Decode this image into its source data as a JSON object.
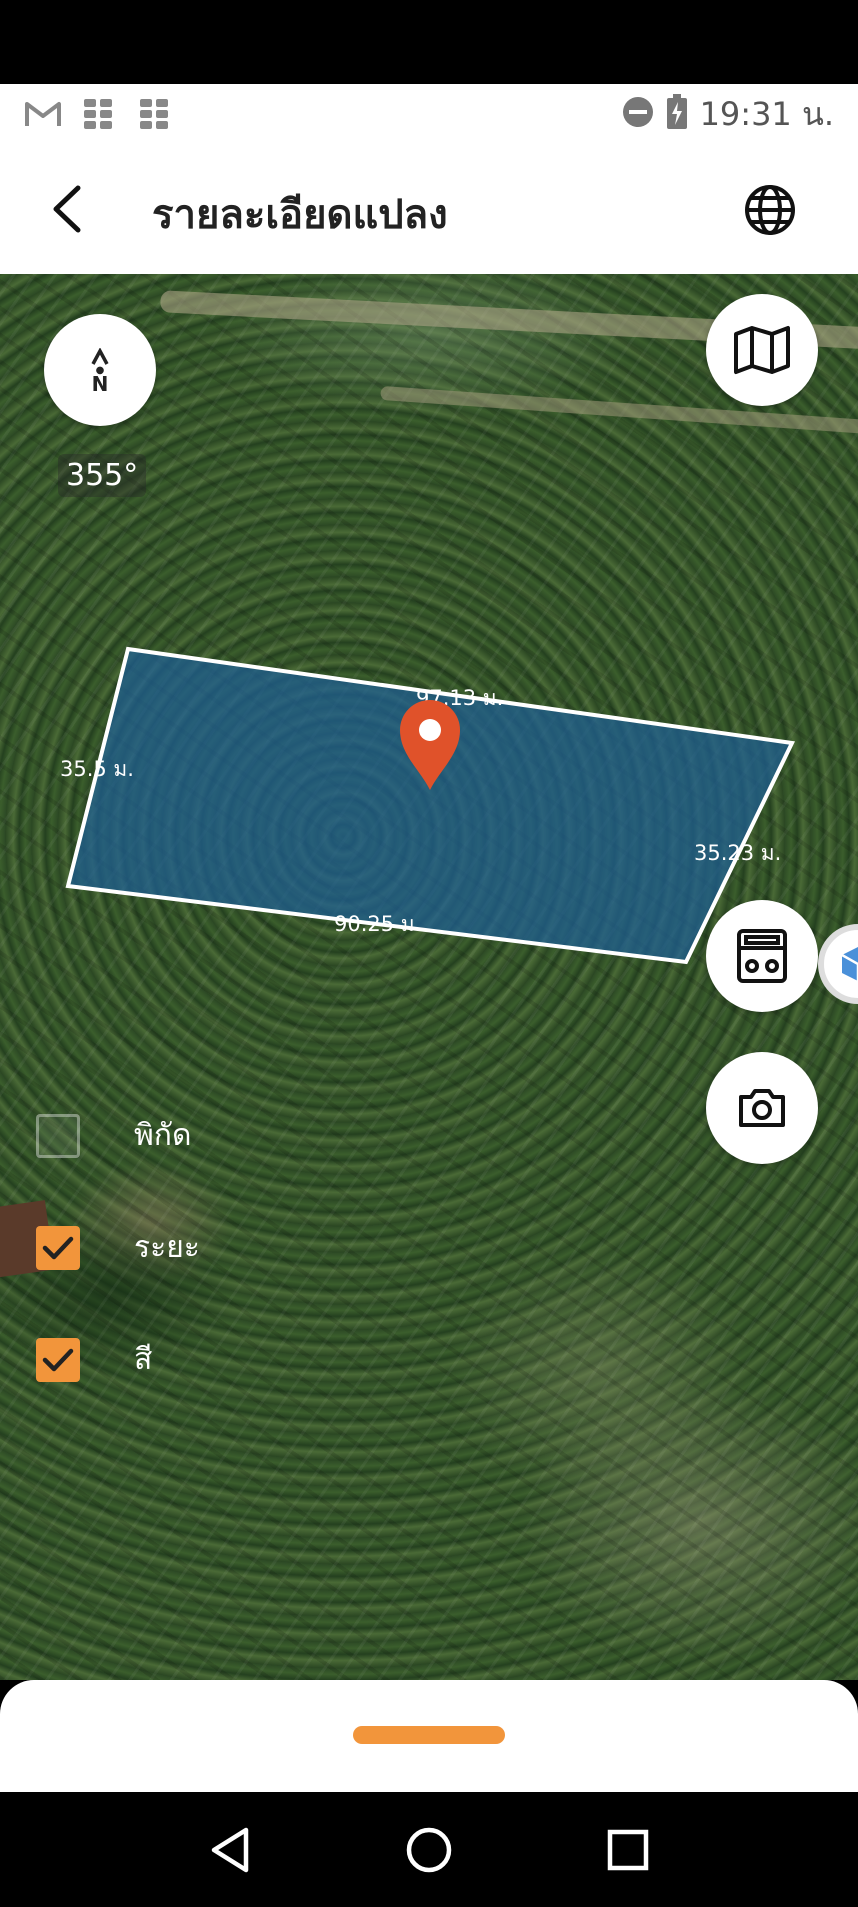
{
  "status_bar": {
    "time": "19:31 น.",
    "icons": [
      "gmail-icon",
      "app-grid-icon",
      "app-grid-icon",
      "do-not-disturb-icon",
      "battery-charging-icon"
    ]
  },
  "app_bar": {
    "title": "รายละเอียดแปลง",
    "back_icon": "arrow-back-icon",
    "globe_icon": "globe-icon"
  },
  "map": {
    "compass_label": "N",
    "bearing": "355°",
    "parcel": {
      "fill_color": "#1f5f95",
      "stroke_color": "#ffffff",
      "marker_color": "#e0522a",
      "edges": [
        {
          "side": "top",
          "length": "97.13 ม."
        },
        {
          "side": "right",
          "length": "35.23 ม."
        },
        {
          "side": "bottom",
          "length": "90.25 ม."
        },
        {
          "side": "left",
          "length": "35.5 ม."
        }
      ]
    },
    "controls": [
      "map-layers-icon",
      "calculator-icon",
      "camera-icon",
      "cube-3d-icon"
    ]
  },
  "layers": [
    {
      "label": "พิกัด",
      "checked": false
    },
    {
      "label": "ระยะ",
      "checked": true
    },
    {
      "label": "สี",
      "checked": true
    }
  ],
  "accent_color": "#f2953b",
  "nav_bar": {
    "icons": [
      "nav-back-icon",
      "nav-home-icon",
      "nav-recents-icon"
    ]
  }
}
